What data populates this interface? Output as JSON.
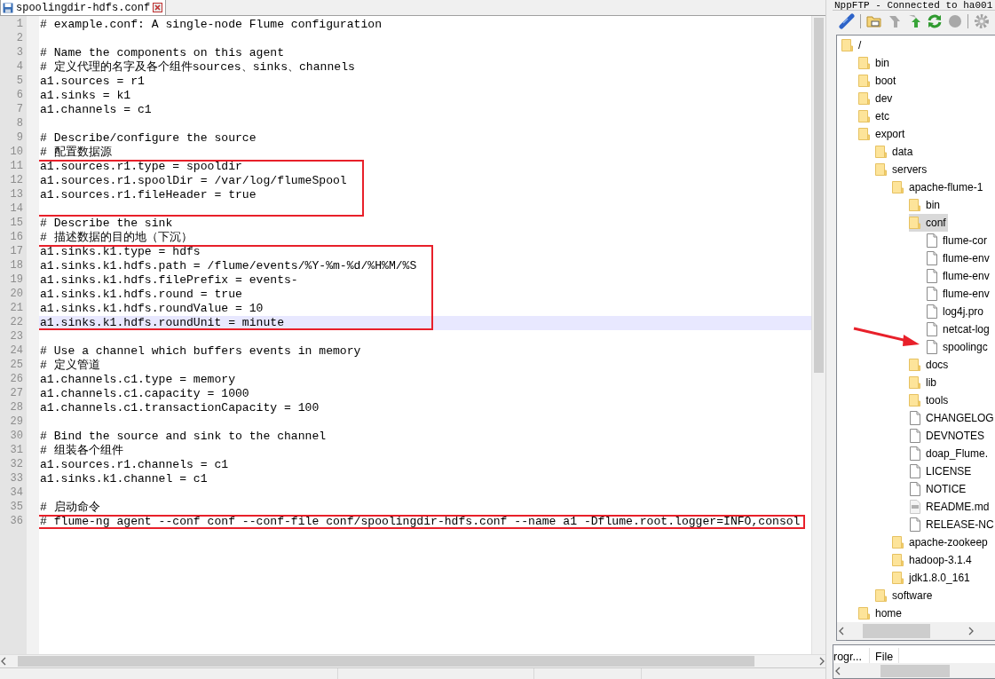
{
  "editor": {
    "tab": {
      "title": "spoolingdir-hdfs.conf",
      "selected": true
    },
    "blocks": [
      {
        "boxed": false,
        "lines": [
          {
            "number": "1",
            "text": "# example.conf: A single-node Flume configuration",
            "current": false
          },
          {
            "number": "2",
            "current": false
          },
          {
            "number": "3",
            "text": "# Name the components on this agent",
            "current": false
          },
          {
            "number": "4",
            "text": "# 定义代理的名字及各个组件sources、sinks、channels",
            "current": false
          },
          {
            "number": "5",
            "text": "a1.sources = r1",
            "current": false
          },
          {
            "number": "6",
            "text": "a1.sinks = k1",
            "current": false
          },
          {
            "number": "7",
            "text": "a1.channels = c1",
            "current": false
          },
          {
            "number": "8",
            "current": false
          },
          {
            "number": "9",
            "text": "# Describe/configure the source",
            "current": false
          },
          {
            "number": "10",
            "text": "# 配置数据源",
            "current": false
          }
        ]
      },
      {
        "boxed": true,
        "lines": [
          {
            "number": "11",
            "text": "a1.sources.r1.type = spooldir",
            "current": false
          },
          {
            "number": "12",
            "text": "a1.sources.r1.spoolDir = /var/log/flumeSpool",
            "current": false
          },
          {
            "number": "13",
            "text": "a1.sources.r1.fileHeader = true",
            "current": false
          },
          {
            "number": "14",
            "current": false
          }
        ]
      },
      {
        "boxed": false,
        "lines": [
          {
            "number": "15",
            "text": "# Describe the sink",
            "current": false
          },
          {
            "number": "16",
            "text": "# 描述数据的目的地（下沉）",
            "current": false
          }
        ]
      },
      {
        "boxed": true,
        "lines": [
          {
            "number": "17",
            "text": "a1.sinks.k1.type = hdfs",
            "current": false
          },
          {
            "number": "18",
            "text": "a1.sinks.k1.hdfs.path = /flume/events/%Y-%m-%d/%H%M/%S",
            "current": false
          },
          {
            "number": "19",
            "text": "a1.sinks.k1.hdfs.filePrefix = events-",
            "current": false
          },
          {
            "number": "20",
            "text": "a1.sinks.k1.hdfs.round = true",
            "current": false
          },
          {
            "number": "21",
            "text": "a1.sinks.k1.hdfs.roundValue = 10",
            "current": false
          },
          {
            "number": "22",
            "text": "a1.sinks.k1.hdfs.roundUnit = minute",
            "current": true
          }
        ]
      },
      {
        "boxed": false,
        "lines": [
          {
            "number": "23",
            "current": false
          },
          {
            "number": "24",
            "text": "# Use a channel which buffers events in memory",
            "current": false
          },
          {
            "number": "25",
            "text": "# 定义管道",
            "current": false
          },
          {
            "number": "26",
            "text": "a1.channels.c1.type = memory",
            "current": false
          },
          {
            "number": "27",
            "text": "a1.channels.c1.capacity = 1000",
            "current": false
          },
          {
            "number": "28",
            "text": "a1.channels.c1.transactionCapacity = 100",
            "current": false
          },
          {
            "number": "29",
            "current": false
          },
          {
            "number": "30",
            "text": "# Bind the source and sink to the channel",
            "current": false
          },
          {
            "number": "31",
            "text": "# 组装各个组件",
            "current": false
          },
          {
            "number": "32",
            "text": "a1.sources.r1.channels = c1",
            "current": false
          },
          {
            "number": "33",
            "text": "a1.sinks.k1.channel = c1",
            "current": false
          },
          {
            "number": "34",
            "current": false
          },
          {
            "number": "35",
            "text": "# 启动命令",
            "current": false
          }
        ]
      },
      {
        "boxed": true,
        "lines": [
          {
            "number": "36",
            "text": "# flume-ng agent --conf conf --conf-file conf/spoolingdir-hdfs.conf --name a1 -Dflume.root.logger=INFO,consol",
            "current": false
          }
        ]
      }
    ]
  },
  "ftp_panel": {
    "title": "NppFTP - Connected to ha001",
    "tree": [
      {
        "label": "/",
        "kind": "folder",
        "selected": false,
        "children": [
          {
            "label": "bin",
            "kind": "folder",
            "selected": false
          },
          {
            "label": "boot",
            "kind": "folder",
            "selected": false
          },
          {
            "label": "dev",
            "kind": "folder",
            "selected": false
          },
          {
            "label": "etc",
            "kind": "folder",
            "selected": false
          },
          {
            "label": "export",
            "kind": "folder",
            "selected": false,
            "children": [
              {
                "label": "data",
                "kind": "folder",
                "selected": false
              },
              {
                "label": "servers",
                "kind": "folder",
                "selected": false,
                "children": [
                  {
                    "label": "apache-flume-1",
                    "kind": "folder",
                    "selected": false,
                    "children": [
                      {
                        "label": "bin",
                        "kind": "folder",
                        "selected": false
                      },
                      {
                        "label": "conf",
                        "kind": "folder",
                        "selected": true,
                        "children": [
                          {
                            "label": "flume-cor",
                            "kind": "file",
                            "selected": false
                          },
                          {
                            "label": "flume-env",
                            "kind": "file",
                            "selected": false
                          },
                          {
                            "label": "flume-env",
                            "kind": "file",
                            "selected": false
                          },
                          {
                            "label": "flume-env",
                            "kind": "file",
                            "selected": false
                          },
                          {
                            "label": "log4j.pro",
                            "kind": "file",
                            "selected": false
                          },
                          {
                            "label": "netcat-log",
                            "kind": "file",
                            "selected": false
                          },
                          {
                            "label": "spoolingc",
                            "kind": "file",
                            "selected": false
                          }
                        ]
                      },
                      {
                        "label": "docs",
                        "kind": "folder",
                        "selected": false
                      },
                      {
                        "label": "lib",
                        "kind": "folder",
                        "selected": false
                      },
                      {
                        "label": "tools",
                        "kind": "folder",
                        "selected": false
                      },
                      {
                        "label": "CHANGELOG",
                        "kind": "file",
                        "selected": false
                      },
                      {
                        "label": "DEVNOTES",
                        "kind": "file",
                        "selected": false
                      },
                      {
                        "label": "doap_Flume.",
                        "kind": "file",
                        "selected": false
                      },
                      {
                        "label": "LICENSE",
                        "kind": "file",
                        "selected": false
                      },
                      {
                        "label": "NOTICE",
                        "kind": "file",
                        "selected": false
                      },
                      {
                        "label": "README.md",
                        "kind": "markdown",
                        "selected": false
                      },
                      {
                        "label": "RELEASE-NC",
                        "kind": "file",
                        "selected": false
                      }
                    ]
                  },
                  {
                    "label": "apache-zookeep",
                    "kind": "folder",
                    "selected": false
                  },
                  {
                    "label": "hadoop-3.1.4",
                    "kind": "folder",
                    "selected": false
                  },
                  {
                    "label": "jdk1.8.0_161",
                    "kind": "folder",
                    "selected": false
                  }
                ]
              },
              {
                "label": "software",
                "kind": "folder",
                "selected": false
              }
            ]
          },
          {
            "label": "home",
            "kind": "folder",
            "selected": false
          }
        ]
      }
    ],
    "queue_columns": [
      "rogr...",
      "File"
    ]
  }
}
